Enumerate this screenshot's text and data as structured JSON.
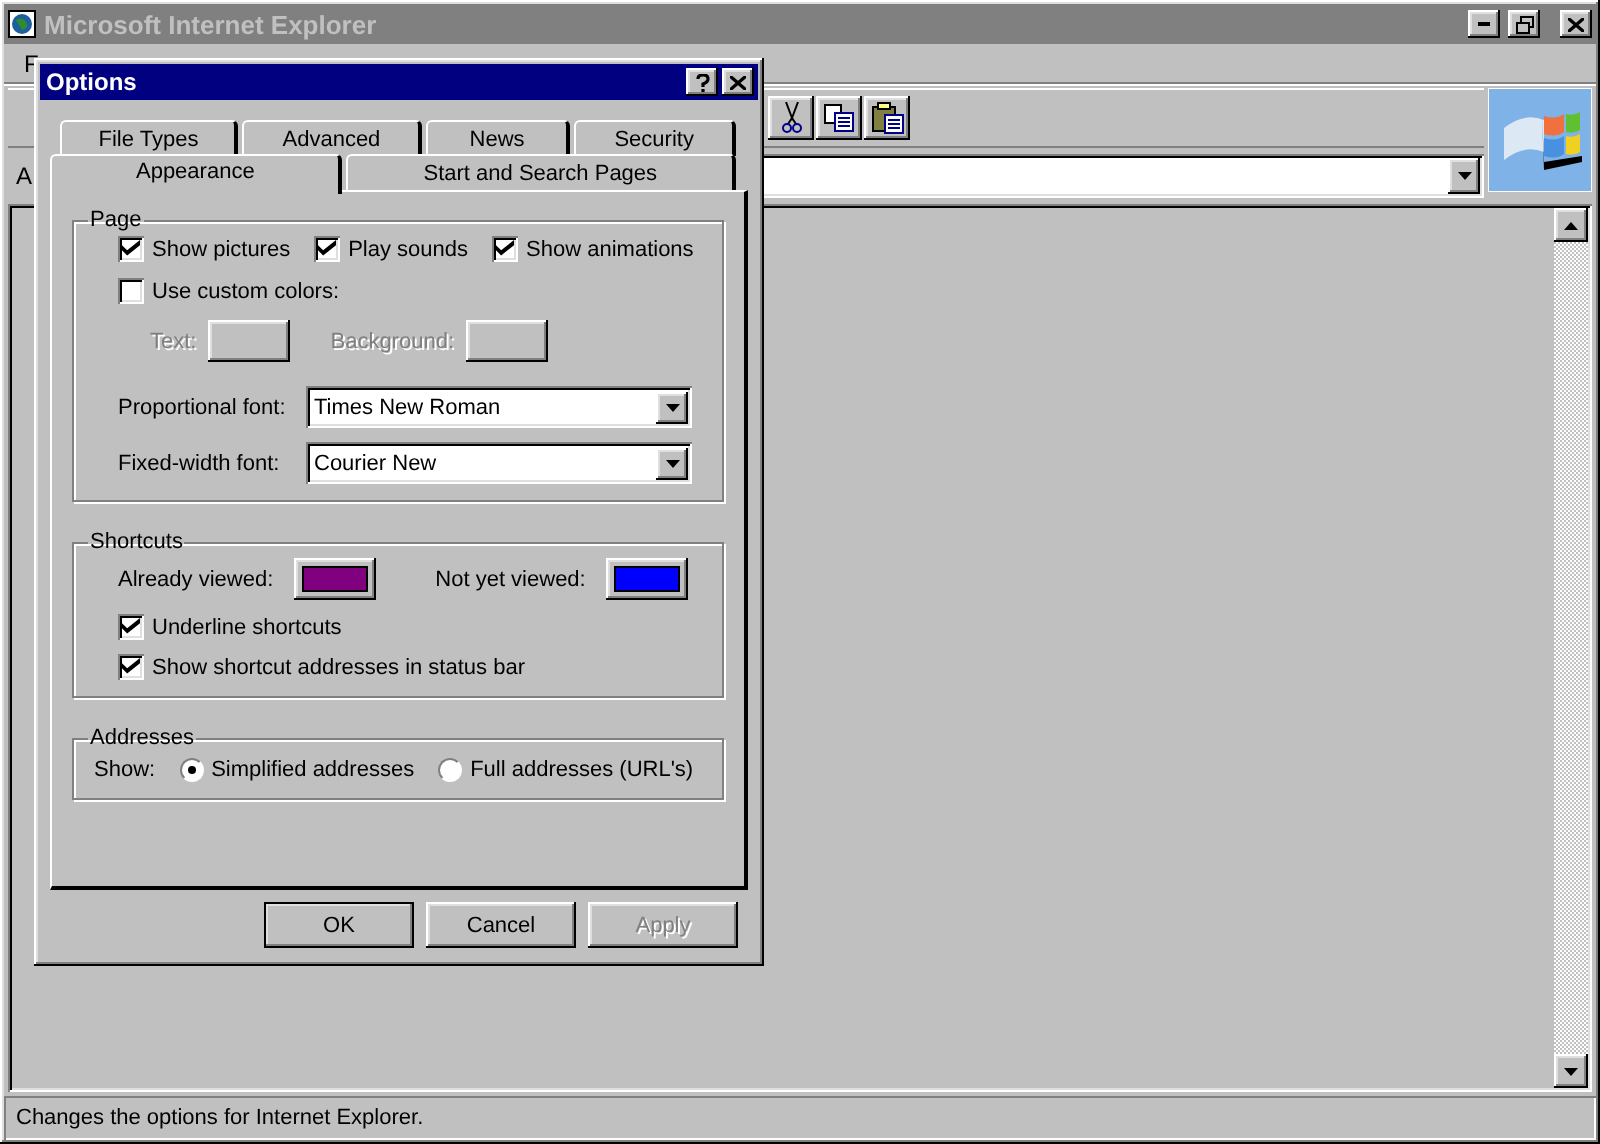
{
  "window": {
    "title": "Microsoft Internet Explorer",
    "active": false
  },
  "menu_bar": [
    "F"
  ],
  "address_bar": {
    "label": "A"
  },
  "dialog": {
    "title": "Options",
    "tabs_back": [
      {
        "label": "File Types",
        "selected": false
      },
      {
        "label": "Advanced",
        "selected": false
      },
      {
        "label": "News",
        "selected": false
      },
      {
        "label": "Security",
        "selected": false
      }
    ],
    "tabs_front": [
      {
        "label": "Appearance",
        "selected": true
      },
      {
        "label": "Start and Search Pages",
        "selected": false
      }
    ],
    "page": {
      "title": "Page",
      "options": [
        {
          "label": "Show pictures",
          "checked": true
        },
        {
          "label": "Play sounds",
          "checked": true
        },
        {
          "label": "Show animations",
          "checked": true
        }
      ],
      "custom_colors": {
        "label": "Use custom colors:",
        "checked": false
      },
      "color_fields": [
        {
          "label": "Text:",
          "disabled": true
        },
        {
          "label": "Background:",
          "disabled": true
        }
      ],
      "fonts": [
        {
          "label": "Proportional font:",
          "value": "Times New Roman"
        },
        {
          "label": "Fixed-width font:",
          "value": "Courier New"
        }
      ]
    },
    "shortcuts": {
      "title": "Shortcuts",
      "colors": [
        {
          "label": "Already viewed:",
          "color": "#800080"
        },
        {
          "label": "Not yet viewed:",
          "color": "#0000ff"
        }
      ],
      "options": [
        {
          "label": "Underline shortcuts",
          "checked": true
        },
        {
          "label": "Show shortcut addresses in status bar",
          "checked": true
        }
      ]
    },
    "addresses": {
      "title": "Addresses",
      "label": "Show:",
      "options": [
        {
          "label": "Simplified addresses",
          "selected": true
        },
        {
          "label": "Full addresses (URL's)",
          "selected": false
        }
      ]
    },
    "buttons": [
      {
        "label": "OK",
        "disabled": false
      },
      {
        "label": "Cancel",
        "disabled": false
      },
      {
        "label": "Apply",
        "disabled": true
      }
    ]
  },
  "status_bar": "Changes the options for Internet Explorer."
}
